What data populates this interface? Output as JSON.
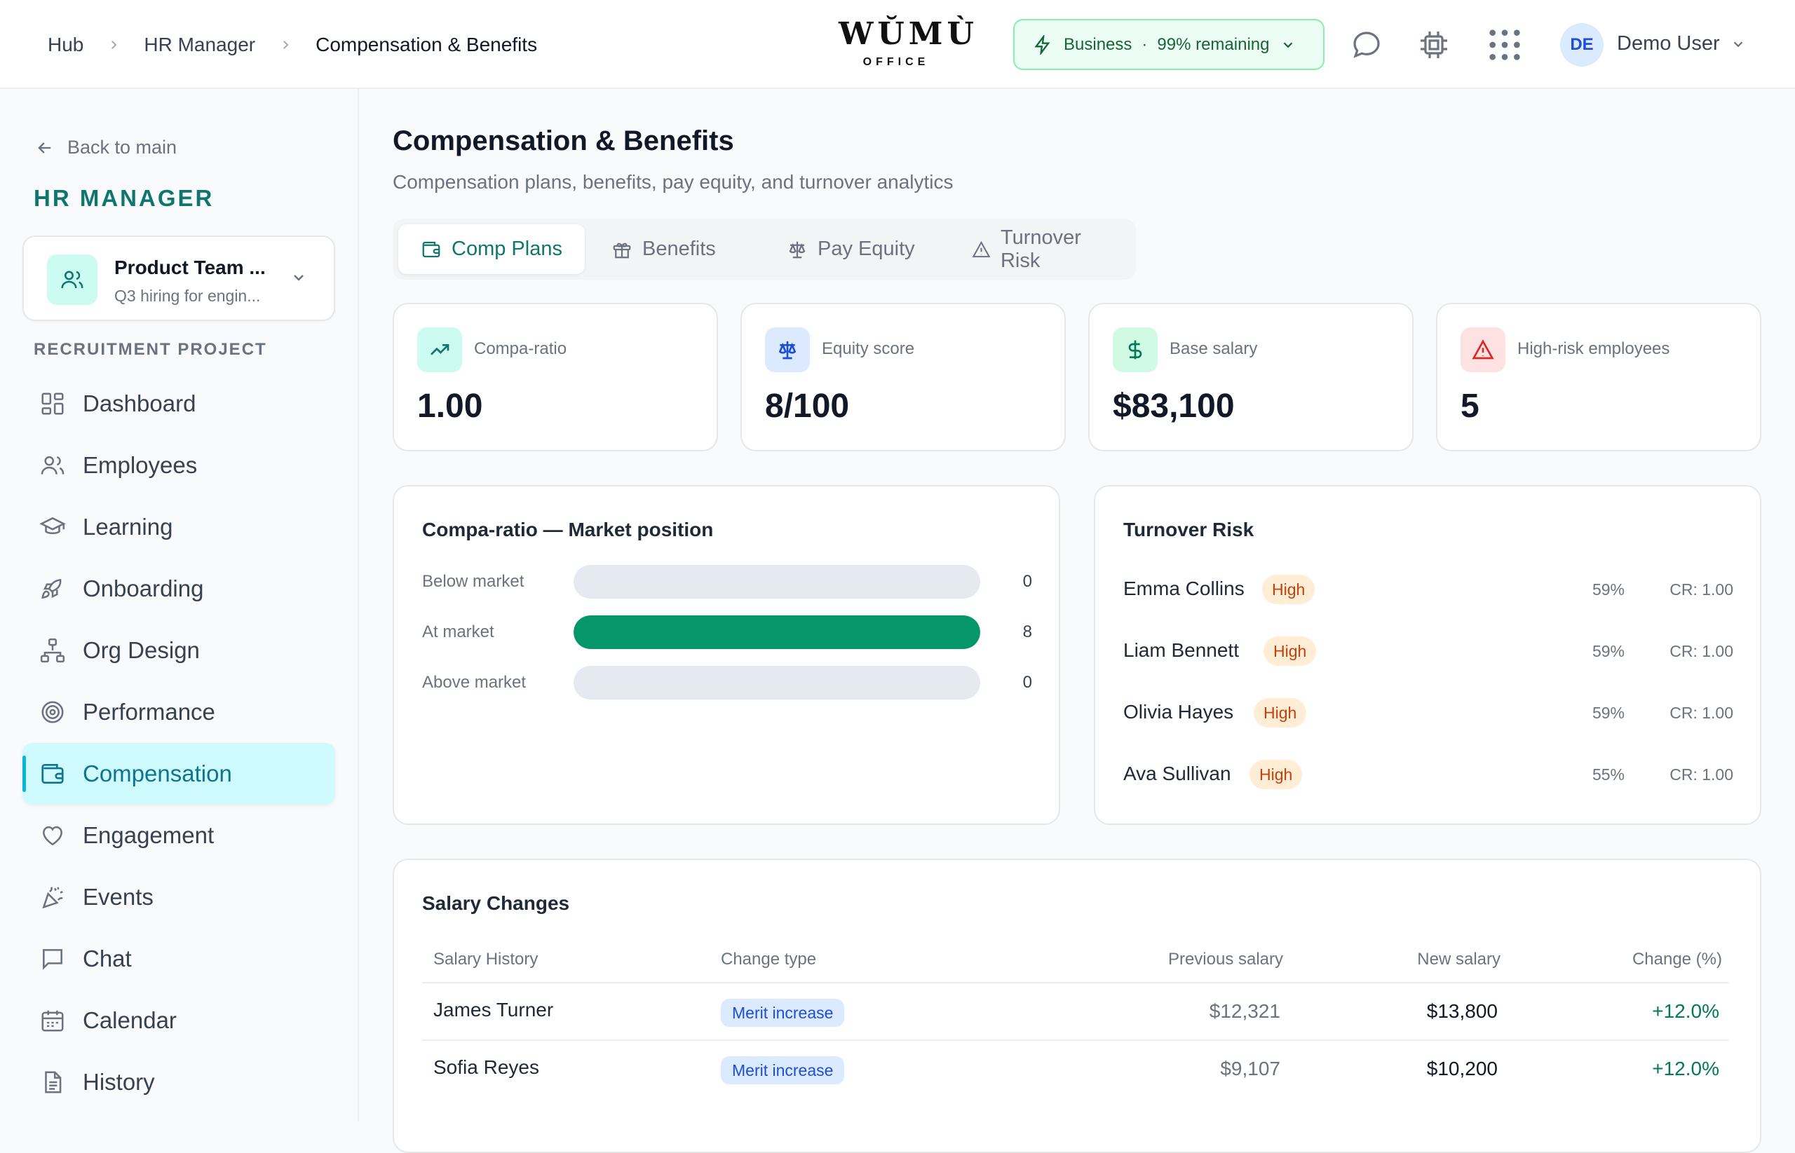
{
  "breadcrumb": [
    "Hub",
    "HR Manager",
    "Compensation & Benefits"
  ],
  "logo": {
    "word": "WŬMÙ",
    "sub": "OFFICE"
  },
  "plan": {
    "name": "Business",
    "remaining": "99% remaining"
  },
  "user": {
    "initials": "DE",
    "name": "Demo User"
  },
  "sidebar": {
    "back": "Back to main",
    "title": "HR MANAGER",
    "project": {
      "name": "Product Team ...",
      "subtitle": "Q3 hiring for engin..."
    },
    "section": "RECRUITMENT PROJECT",
    "items": [
      {
        "label": "Dashboard",
        "icon": "dashboard-icon"
      },
      {
        "label": "Employees",
        "icon": "users-icon"
      },
      {
        "label": "Learning",
        "icon": "graduation-cap-icon"
      },
      {
        "label": "Onboarding",
        "icon": "rocket-icon"
      },
      {
        "label": "Org Design",
        "icon": "org-chart-icon"
      },
      {
        "label": "Performance",
        "icon": "target-icon"
      },
      {
        "label": "Compensation",
        "icon": "wallet-icon",
        "active": true
      },
      {
        "label": "Engagement",
        "icon": "heart-icon"
      },
      {
        "label": "Events",
        "icon": "party-popper-icon"
      },
      {
        "label": "Chat",
        "icon": "chat-icon"
      },
      {
        "label": "Calendar",
        "icon": "calendar-icon"
      },
      {
        "label": "History",
        "icon": "document-icon"
      }
    ]
  },
  "page": {
    "title": "Compensation & Benefits",
    "subtitle": "Compensation plans, benefits, pay equity, and turnover analytics"
  },
  "tabs": [
    {
      "label": "Comp Plans",
      "icon": "wallet-icon",
      "active": true
    },
    {
      "label": "Benefits",
      "icon": "gift-icon"
    },
    {
      "label": "Pay Equity",
      "icon": "scale-icon"
    },
    {
      "label": "Turnover Risk",
      "icon": "warning-icon"
    }
  ],
  "kpis": [
    {
      "label": "Compa-ratio",
      "value": "1.00",
      "icon": "trending-up-icon",
      "color": "#0f766e",
      "bg": "#ccfbf1"
    },
    {
      "label": "Equity score",
      "value": "8/100",
      "icon": "scale-icon",
      "color": "#1d4ed8",
      "bg": "#dbeafe"
    },
    {
      "label": "Base salary",
      "value": "$83,100",
      "icon": "dollar-icon",
      "color": "#047857",
      "bg": "#d1fae5"
    },
    {
      "label": "High-risk employees",
      "value": "5",
      "icon": "warning-icon",
      "color": "#dc2626",
      "bg": "#fee2e2"
    }
  ],
  "market": {
    "title": "Compa-ratio — Market position",
    "max": 8,
    "rows": [
      {
        "label": "Below market",
        "value": 0
      },
      {
        "label": "At market",
        "value": 8
      },
      {
        "label": "Above market",
        "value": 0
      }
    ]
  },
  "turnover": {
    "title": "Turnover Risk",
    "rows": [
      {
        "name": "Emma Collins",
        "level": "High",
        "pct": "59%",
        "cr": "CR: 1.00"
      },
      {
        "name": "Liam Bennett",
        "level": "High",
        "pct": "59%",
        "cr": "CR: 1.00"
      },
      {
        "name": "Olivia Hayes",
        "level": "High",
        "pct": "59%",
        "cr": "CR: 1.00"
      },
      {
        "name": "Ava Sullivan",
        "level": "High",
        "pct": "55%",
        "cr": "CR: 1.00"
      }
    ]
  },
  "salary": {
    "title": "Salary Changes",
    "columns": [
      "Salary History",
      "Change type",
      "Previous salary",
      "New salary",
      "Change (%)"
    ],
    "rows": [
      {
        "name": "James Turner",
        "type": "Merit increase",
        "prev": "$12,321",
        "new": "$13,800",
        "change": "+12.0%"
      },
      {
        "name": "Sofia Reyes",
        "type": "Merit increase",
        "prev": "$9,107",
        "new": "$10,200",
        "change": "+12.0%"
      }
    ]
  }
}
